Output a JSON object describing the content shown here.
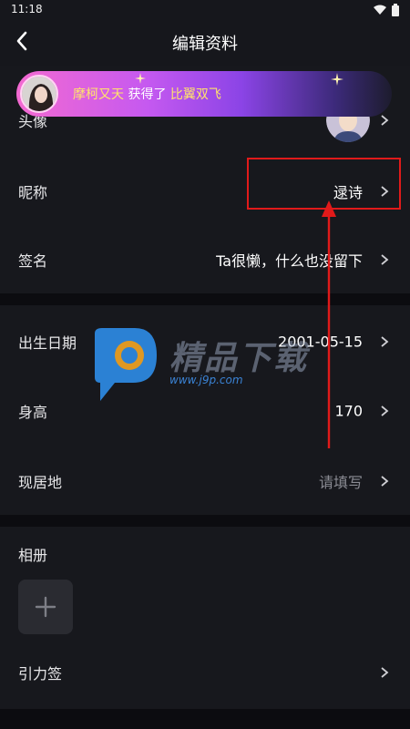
{
  "status": {
    "time": "11:18"
  },
  "header": {
    "title": "编辑资料"
  },
  "banner": {
    "user": "摩柯又天",
    "action": "获得了",
    "item": "比翼双飞"
  },
  "profile": {
    "avatar_label": "头像",
    "nickname_label": "昵称",
    "nickname_value": "逯诗",
    "signature_label": "签名",
    "signature_value": "Ta很懒，什么也没留下"
  },
  "info": {
    "birthday_label": "出生日期",
    "birthday_value": "2001-05-15",
    "height_label": "身高",
    "height_value": "170",
    "location_label": "现居地",
    "location_value": "请填写"
  },
  "album": {
    "label": "相册",
    "add_icon": "plus-icon"
  },
  "gravity": {
    "label": "引力签"
  },
  "watermark": {
    "text": "精品下载",
    "url": "www.j9p.com"
  },
  "colors": {
    "background": "#0c0c10",
    "section": "#17181d",
    "accent_highlight": "#e11a1a",
    "banner_gradient_start": "#f36ad1",
    "banner_highlight_text": "#ffe46b"
  }
}
